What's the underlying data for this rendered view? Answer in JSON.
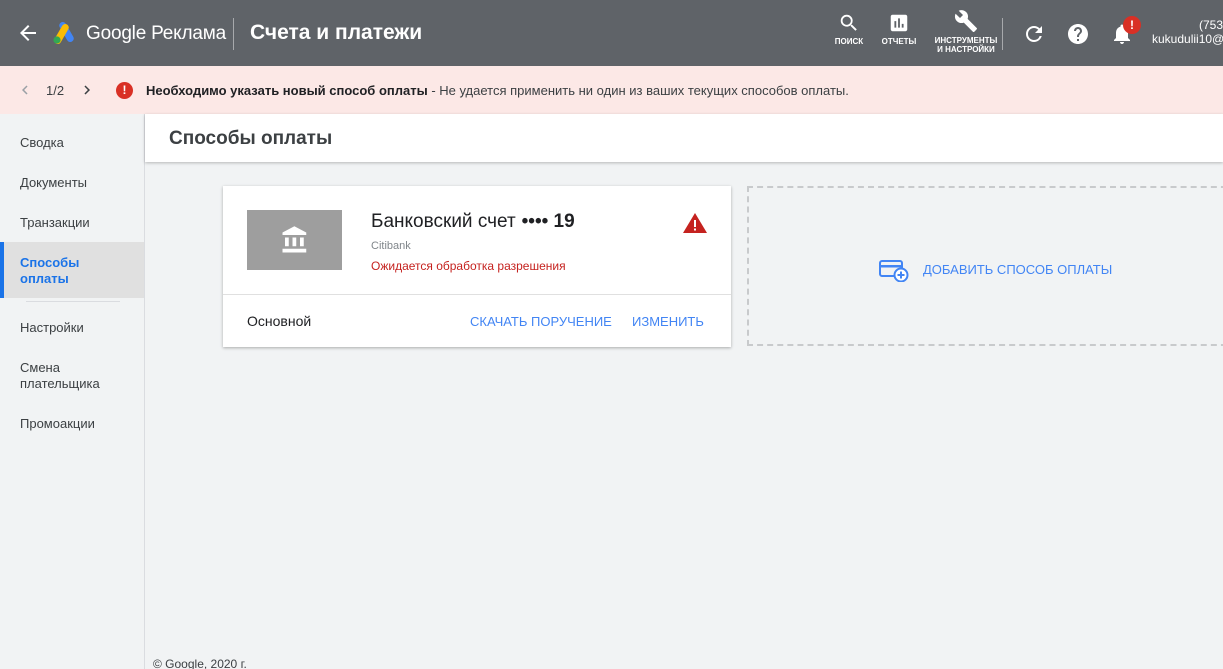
{
  "header": {
    "brand": "Google Реклама",
    "page_title": "Счета и платежи",
    "tools": {
      "search": "ПОИСК",
      "reports": "ОТЧЕТЫ",
      "tools_line1": "ИНСТРУМЕНТЫ",
      "tools_line2": "И НАСТРОЙКИ"
    },
    "notification_badge": "!",
    "account_line1": "(753",
    "account_line2": "kukudulii10@"
  },
  "alert": {
    "counter": "1/2",
    "icon": "!",
    "title": "Необходимо указать новый способ оплаты",
    "message": " - Не удается применить ни один из ваших текущих способов оплаты."
  },
  "sidebar": {
    "items": [
      {
        "label": "Сводка"
      },
      {
        "label": "Документы"
      },
      {
        "label": "Транзакции"
      },
      {
        "label": "Способы оплаты"
      },
      {
        "label": "Настройки"
      },
      {
        "label": "Смена плательщика"
      },
      {
        "label": "Промоакции"
      }
    ]
  },
  "main": {
    "section_title": "Способы оплаты",
    "payment_card": {
      "name": "Банковский счет",
      "number": "•••• 19",
      "bank": "Citibank",
      "status": "Ожидается обработка разрешения",
      "primary_label": "Основной",
      "download_link": "СКАЧАТЬ ПОРУЧЕНИЕ",
      "edit_link": "ИЗМЕНИТЬ"
    },
    "add_payment_label": "ДОБАВИТЬ СПОСОБ ОПЛАТЫ"
  },
  "footer": "© Google, 2020 г.",
  "colors": {
    "topbar": "#5f6368",
    "alert_bg": "#fce8e6",
    "accent": "#1a73e8",
    "link": "#4285f4",
    "error": "#d93025"
  }
}
